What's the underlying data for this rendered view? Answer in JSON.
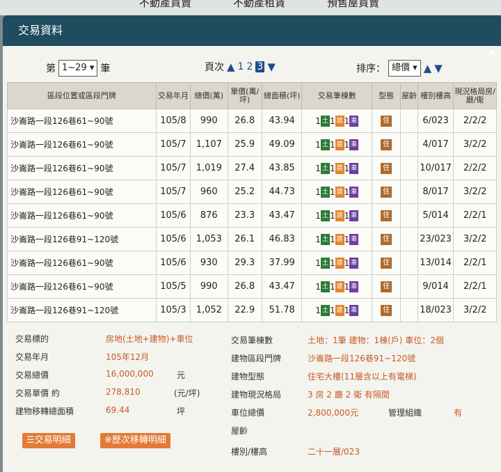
{
  "top_nav": [
    "不動產買賣",
    "不動產租賃",
    "預售屋買賣"
  ],
  "dialog": {
    "title": "交易資料",
    "close_icon": "close-icon"
  },
  "controls": {
    "range_prefix": "第",
    "range_value": "1~29",
    "range_suffix": "筆",
    "page_label": "頁次",
    "pages": [
      "1",
      "2",
      "3"
    ],
    "current_page": "3",
    "sort_label": "排序：",
    "sort_value": "總價"
  },
  "table": {
    "headers": [
      "區段位置或區段門牌",
      "交易年月",
      "總價(萬)",
      "單價(萬/坪)",
      "總面積(坪)",
      "交易筆棟數",
      "型態",
      "屋齡",
      "樓別樓高",
      "現況格局房/廳/衛"
    ],
    "building_badges": {
      "land": "土",
      "building": "建",
      "parking": "車",
      "type": "住"
    },
    "rows": [
      {
        "addr": "沙崙路一段126巷61~90號",
        "ym": "105/8",
        "total": "990",
        "unit": "26.8",
        "area": "43.94",
        "land": "1",
        "bldg": "1",
        "park": "1",
        "age": "",
        "floor": "6/023",
        "layout": "2/2/2"
      },
      {
        "addr": "沙崙路一段126巷61~90號",
        "ym": "105/7",
        "total": "1,107",
        "unit": "25.9",
        "area": "49.09",
        "land": "1",
        "bldg": "1",
        "park": "1",
        "age": "",
        "floor": "4/017",
        "layout": "3/2/2"
      },
      {
        "addr": "沙崙路一段126巷61~90號",
        "ym": "105/7",
        "total": "1,019",
        "unit": "27.4",
        "area": "43.85",
        "land": "1",
        "bldg": "1",
        "park": "1",
        "age": "",
        "floor": "10/017",
        "layout": "2/2/2"
      },
      {
        "addr": "沙崙路一段126巷61~90號",
        "ym": "105/7",
        "total": "960",
        "unit": "25.2",
        "area": "44.73",
        "land": "1",
        "bldg": "1",
        "park": "1",
        "age": "",
        "floor": "8/017",
        "layout": "3/2/2"
      },
      {
        "addr": "沙崙路一段126巷61~90號",
        "ym": "105/6",
        "total": "876",
        "unit": "23.3",
        "area": "43.47",
        "land": "1",
        "bldg": "1",
        "park": "1",
        "age": "",
        "floor": "5/014",
        "layout": "2/2/1"
      },
      {
        "addr": "沙崙路一段126巷91~120號",
        "ym": "105/6",
        "total": "1,053",
        "unit": "26.1",
        "area": "46.83",
        "land": "1",
        "bldg": "1",
        "park": "1",
        "age": "",
        "floor": "23/023",
        "layout": "3/2/2"
      },
      {
        "addr": "沙崙路一段126巷61~90號",
        "ym": "105/6",
        "total": "930",
        "unit": "29.3",
        "area": "37.99",
        "land": "1",
        "bldg": "1",
        "park": "1",
        "age": "",
        "floor": "13/014",
        "layout": "2/2/1"
      },
      {
        "addr": "沙崙路一段126巷61~90號",
        "ym": "105/5",
        "total": "990",
        "unit": "26.8",
        "area": "43.47",
        "land": "1",
        "bldg": "1",
        "park": "1",
        "age": "",
        "floor": "9/014",
        "layout": "2/2/1"
      },
      {
        "addr": "沙崙路一段126巷91~120號",
        "ym": "105/3",
        "total": "1,052",
        "unit": "22.9",
        "area": "51.78",
        "land": "1",
        "bldg": "1",
        "park": "1",
        "age": "",
        "floor": "18/023",
        "layout": "3/2/2"
      }
    ]
  },
  "details": {
    "target_label": "交易標的",
    "target_value": "房地(土地+建物)+車位",
    "ym_label": "交易年月",
    "ym_value": "105年12月",
    "total_label": "交易總價",
    "total_value": "16,000,000",
    "total_unit": "元",
    "unit_label": "交易單價 約",
    "unit_value": "278,810",
    "unit_unit": "(元/坪)",
    "area_label": "建物移轉總面積",
    "area_value": "69.44",
    "area_unit": "坪",
    "count_label": "交易筆棟數",
    "count_value": "土地：1筆 建物：1棟(戶) 車位：2個",
    "addr_label": "建物區段門牌",
    "addr_value": "沙崙路一段126巷91~120號",
    "type_label": "建物型態",
    "type_value": "住宅大樓(11層含以上有電梯)",
    "layout_label": "建物現況格局",
    "layout_value": "3 房 2 廳 2 衛 有隔間",
    "parking_label": "車位總價",
    "parking_value": "2,800,000元",
    "mgmt_label": "管理組織",
    "mgmt_value": "有",
    "age_label": "屋齡",
    "floor_label": "樓別/樓高",
    "floor_value": "二十一層/023",
    "btn_detail": "☰交易明細",
    "btn_history": "※歷次移轉明細"
  }
}
